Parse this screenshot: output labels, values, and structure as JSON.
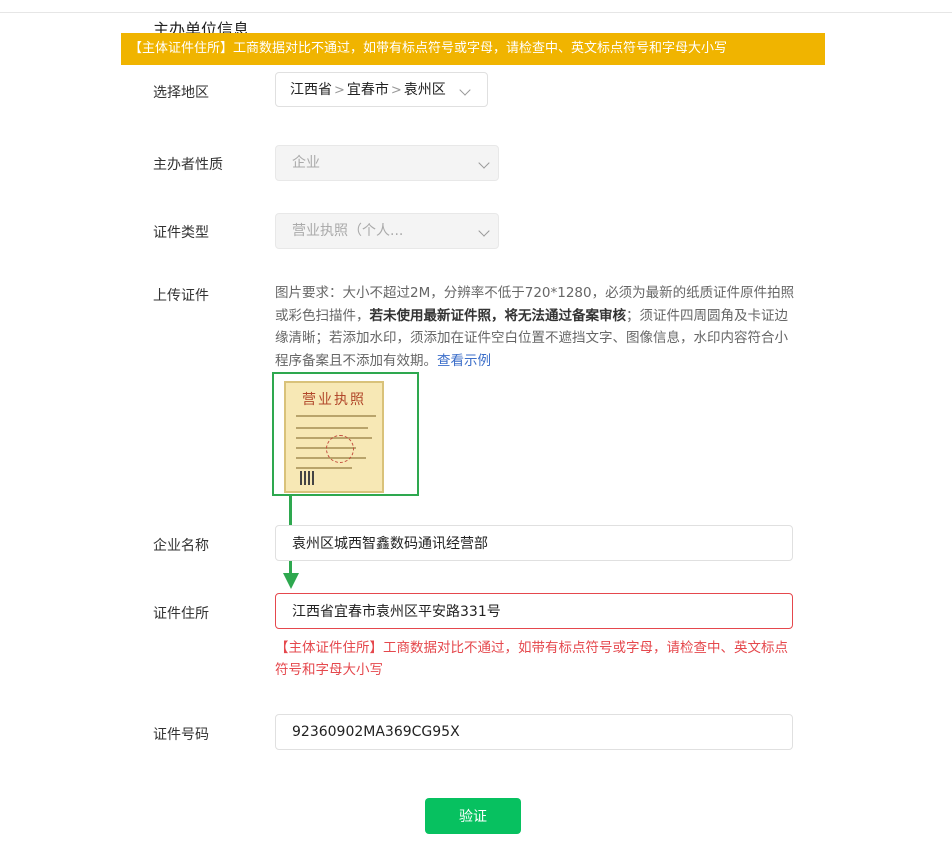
{
  "section_title": "主办单位信息",
  "banner": "【主体证件住所】工商数据对比不通过，如带有标点符号或字母，请检查中、英文标点符号和字母大小写",
  "region": {
    "label": "选择地区",
    "province": "江西省",
    "city": "宜春市",
    "district": "袁州区",
    "separator": ">"
  },
  "organizer_type": {
    "label": "主办者性质",
    "value": "企业"
  },
  "cert_type": {
    "label": "证件类型",
    "value": "营业执照（个人..."
  },
  "upload": {
    "label": "上传证件",
    "help_part1": "图片要求：大小不超过2M，分辨率不低于720*1280，必须为最新的纸质证件原件拍照或彩色扫描件，",
    "help_bold": "若未使用最新证件照，将无法通过备案审核",
    "help_part2": "；须证件四周圆角及卡证边缘清晰；若添加水印，须添加在证件空白位置不遮挡文字、图像信息，水印内容符合小程序备案且不添加有效期。",
    "help_link": "查看示例",
    "license_title": "营业执照"
  },
  "company_name": {
    "label": "企业名称",
    "value": "袁州区城西智鑫数码通讯经营部"
  },
  "cert_address": {
    "label": "证件住所",
    "value": "江西省宜春市袁州区平安路331号",
    "error": "【主体证件住所】工商数据对比不通过，如带有标点符号或字母，请检查中、英文标点符号和字母大小写"
  },
  "cert_number": {
    "label": "证件号码",
    "value": "92360902MA369CG95X"
  },
  "verify_button": "验证",
  "colors": {
    "banner_bg": "#f0b400",
    "error_red": "#e5484d",
    "primary_green": "#07c160",
    "annotation_green": "#2ea84f",
    "link_blue": "#3b6ec9"
  }
}
